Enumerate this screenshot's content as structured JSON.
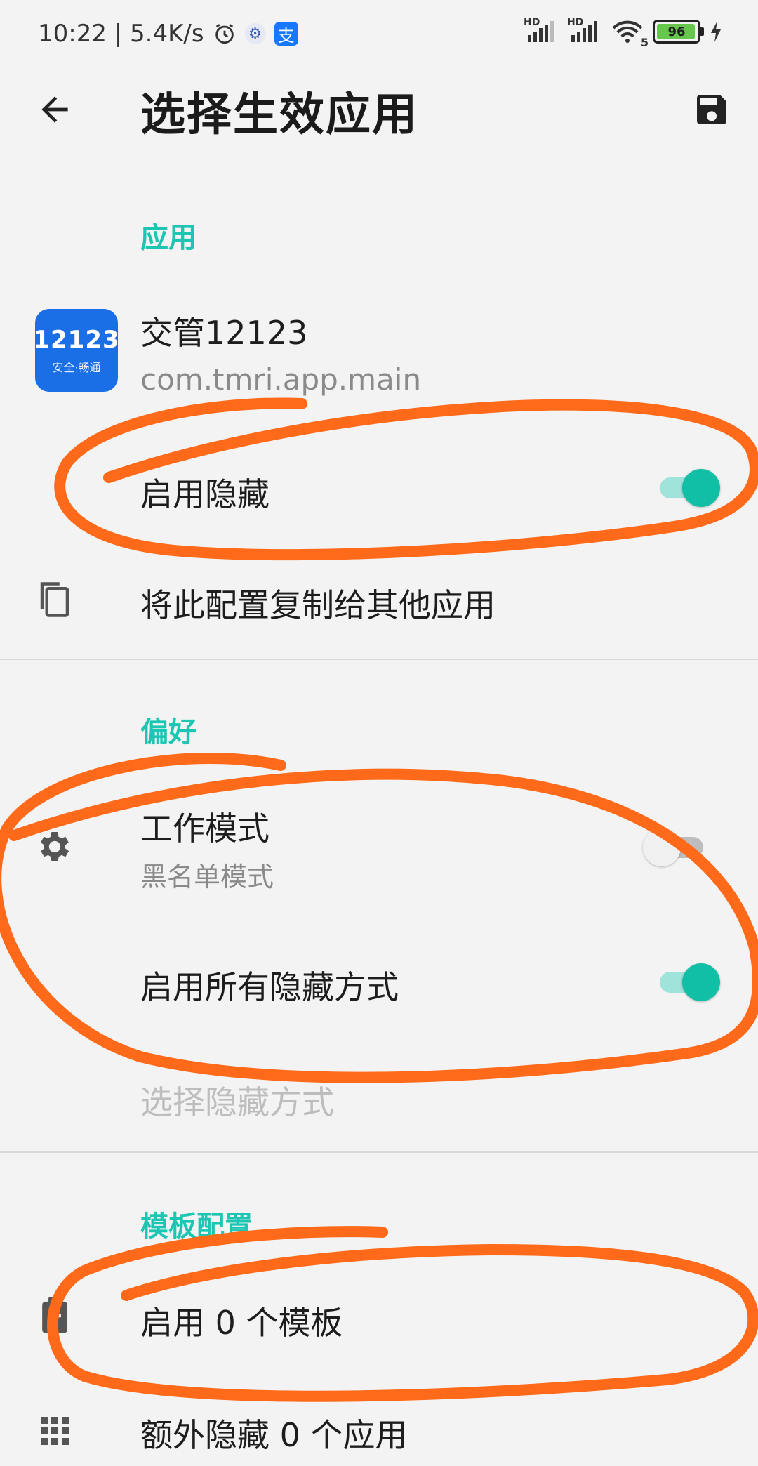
{
  "status_bar": {
    "time_speed": "10:22 | 5.4K/s",
    "hd1": "HD",
    "hd2": "HD",
    "wifi_label": "5",
    "battery": "96",
    "battery_level": 0.96
  },
  "header": {
    "title": "选择生效应用"
  },
  "sections": {
    "app": {
      "title": "应用",
      "app_name": "交管12123",
      "package": "com.tmri.app.main",
      "app_icon_text": "12123",
      "app_icon_subtext": "安全·畅通",
      "enable_hide_label": "启用隐藏",
      "enable_hide_on": true,
      "copy_label": "将此配置复制给其他应用"
    },
    "preferences": {
      "title": "偏好",
      "work_mode_label": "工作模式",
      "work_mode_value": "黑名单模式",
      "work_mode_on": false,
      "all_methods_label": "启用所有隐藏方式",
      "all_methods_on": true,
      "choose_methods_label": "选择隐藏方式"
    },
    "templates": {
      "title": "模板配置",
      "enabled_templates": "启用 0 个模板",
      "extra_hidden_apps": "额外隐藏 0 个应用"
    }
  },
  "colors": {
    "accent": "#1cc6b2",
    "switch_on": "#11bfa7",
    "annotation": "#ff6a1a",
    "background": "#f3f3f3"
  },
  "icons": [
    "alarm-icon",
    "settings-icon",
    "alipay-icon",
    "signal-icon",
    "wifi-icon",
    "battery-icon",
    "charging-icon",
    "back-arrow-icon",
    "save-icon",
    "copy-icon",
    "gear-icon",
    "clipboard-icon",
    "grid-icon"
  ]
}
